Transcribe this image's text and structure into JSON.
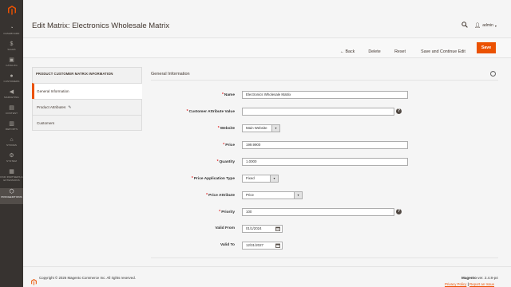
{
  "colors": {
    "accent": "#eb5202",
    "sidebar": "#373330",
    "text": "#41362f"
  },
  "sidebar": {
    "logo": "magento-logo-icon",
    "items": [
      {
        "label": "DASHBOARD",
        "icon": "dashboard-icon"
      },
      {
        "label": "SALES",
        "icon": "dollar-icon"
      },
      {
        "label": "CATALOG",
        "icon": "cube-icon"
      },
      {
        "label": "CUSTOMERS",
        "icon": "person-icon"
      },
      {
        "label": "MARKETING",
        "icon": "megaphone-icon"
      },
      {
        "label": "CONTENT",
        "icon": "content-icon"
      },
      {
        "label": "REPORTS",
        "icon": "bar-chart-icon"
      },
      {
        "label": "STORES",
        "icon": "store-icon"
      },
      {
        "label": "SYSTEM",
        "icon": "gear-icon"
      },
      {
        "label": "FIND PARTNERS & EXTENSIONS",
        "icon": "partners-icon"
      },
      {
        "label": "PROCEEDITIONS",
        "icon": "hexagon-icon"
      }
    ]
  },
  "header": {
    "title": "Edit Matrix: Electronics Wholesale Matrix",
    "user": "admin"
  },
  "actions": {
    "back": "Back",
    "delete": "Delete",
    "reset": "Reset",
    "save_continue": "Save and Continue Edit",
    "save": "Save"
  },
  "tabs": {
    "title": "PRODUCT CUSTOMER MATRIX INFORMATION",
    "items": [
      "General Information",
      "Product Attributes",
      "Customers"
    ]
  },
  "form": {
    "section_title": "General Information",
    "name_label": "Name",
    "name_value": "Electronics Wholesale Matrix",
    "customer_attr_label": "Customer Attribute Value",
    "customer_attr_value": "",
    "website_label": "Website",
    "website_value": "Main Website",
    "price_label": "Price",
    "price_value": "199.9900",
    "quantity_label": "Quantity",
    "quantity_value": "1.0000",
    "price_app_type_label": "Price Application Type",
    "price_app_type_value": "Fixed",
    "price_attr_label": "Price Attribute",
    "price_attr_value": "Price",
    "priority_label": "Priority",
    "priority_value": "100",
    "valid_from_label": "Valid From",
    "valid_from_value": "01/1/2024",
    "valid_to_label": "Valid To",
    "valid_to_value": "12/31/2027",
    "required_mark": "*"
  },
  "footer": {
    "copyright": "Copyright © 2026 Magento Commerce Inc. All rights reserved.",
    "brand": "Magento",
    "version": "ver. 2.4.8-p4",
    "privacy": "Privacy Policy",
    "report": "Report an Issue",
    "separator": "|"
  }
}
